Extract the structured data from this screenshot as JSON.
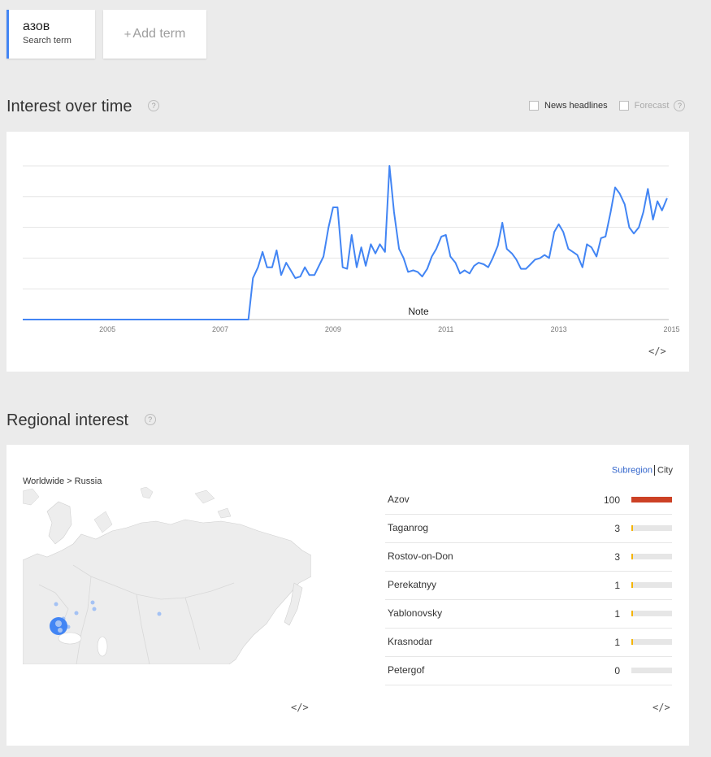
{
  "search": {
    "term": "азов",
    "term_label": "Search term",
    "add_plus": "+",
    "add_label": "Add term"
  },
  "interest_over_time": {
    "title": "Interest over time",
    "help": "?",
    "news_label": "News headlines",
    "forecast_label": "Forecast",
    "note_label": "Note",
    "embed": "</>"
  },
  "chart_data": {
    "type": "line",
    "title": "",
    "xlabel": "",
    "ylabel": "",
    "x_ticks": [
      "2005",
      "2007",
      "2009",
      "2011",
      "2013",
      "2015"
    ],
    "xlim": [
      2004.0,
      2015.45
    ],
    "ylim": [
      0,
      100
    ],
    "grid": true,
    "series": [
      {
        "color": "#4285f4",
        "x": [
          2004.0,
          2008.0,
          2008.08,
          2008.17,
          2008.25,
          2008.33,
          2008.42,
          2008.5,
          2008.58,
          2008.67,
          2008.75,
          2008.83,
          2008.92,
          2009.0,
          2009.08,
          2009.17,
          2009.25,
          2009.33,
          2009.42,
          2009.5,
          2009.58,
          2009.67,
          2009.75,
          2009.83,
          2009.92,
          2010.0,
          2010.08,
          2010.17,
          2010.25,
          2010.33,
          2010.42,
          2010.5,
          2010.58,
          2010.67,
          2010.75,
          2010.83,
          2010.92,
          2011.0,
          2011.08,
          2011.17,
          2011.25,
          2011.33,
          2011.42,
          2011.5,
          2011.58,
          2011.67,
          2011.75,
          2011.83,
          2011.92,
          2012.0,
          2012.08,
          2012.17,
          2012.25,
          2012.33,
          2012.42,
          2012.5,
          2012.58,
          2012.67,
          2012.75,
          2012.83,
          2012.92,
          2013.0,
          2013.08,
          2013.17,
          2013.25,
          2013.33,
          2013.42,
          2013.5,
          2013.58,
          2013.67,
          2013.75,
          2013.83,
          2013.92,
          2014.0,
          2014.08,
          2014.17,
          2014.25,
          2014.33,
          2014.42,
          2014.5,
          2014.58,
          2014.67,
          2014.75,
          2014.83,
          2014.92,
          2015.0,
          2015.08,
          2015.17,
          2015.25,
          2015.33,
          2015.42
        ],
        "values": [
          0,
          0,
          27,
          34,
          44,
          34,
          34,
          45,
          29,
          37,
          32,
          27,
          28,
          34,
          29,
          29,
          35,
          41,
          60,
          73,
          73,
          34,
          33,
          55,
          34,
          47,
          35,
          49,
          43,
          49,
          44,
          100,
          70,
          46,
          40,
          31,
          32,
          31,
          28,
          33,
          41,
          46,
          54,
          55,
          41,
          37,
          30,
          32,
          30,
          35,
          37,
          36,
          34,
          40,
          48,
          63,
          46,
          43,
          39,
          33,
          33,
          36,
          39,
          40,
          42,
          40,
          57,
          62,
          57,
          46,
          44,
          42,
          34,
          49,
          47,
          41,
          53,
          54,
          70,
          86,
          82,
          75,
          60,
          56,
          60,
          70,
          85,
          65,
          77,
          71,
          79
        ]
      }
    ]
  },
  "regional": {
    "title": "Regional interest",
    "help": "?",
    "breadcrumb": "Worldwide > Russia",
    "toggle_subregion": "Subregion",
    "toggle_city": "City",
    "embed_map": "</>",
    "embed_list": "</>",
    "rows": [
      {
        "name": "Azov",
        "value": "100",
        "fill": 1.0,
        "color": "#cc4125"
      },
      {
        "name": "Taganrog",
        "value": "3",
        "fill": 0.03,
        "color": "#f4b400"
      },
      {
        "name": "Rostov-on-Don",
        "value": "3",
        "fill": 0.03,
        "color": "#f4b400"
      },
      {
        "name": "Perekatnyy",
        "value": "1",
        "fill": 0.01,
        "color": "#f4b400"
      },
      {
        "name": "Yablonovsky",
        "value": "1",
        "fill": 0.01,
        "color": "#f4b400"
      },
      {
        "name": "Krasnodar",
        "value": "1",
        "fill": 0.01,
        "color": "#f4b400"
      },
      {
        "name": "Petergof",
        "value": "0",
        "fill": 0.0,
        "color": "#f4b400"
      }
    ]
  }
}
